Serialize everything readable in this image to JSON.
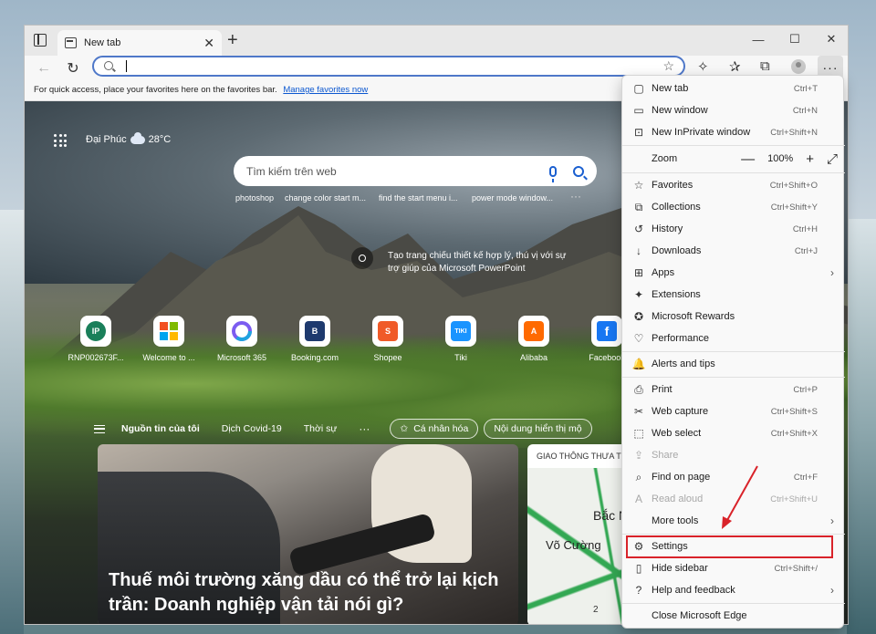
{
  "tab": {
    "title": "New tab",
    "close": "✕",
    "new": "+"
  },
  "window_controls": {
    "minimize": "—",
    "maximize": "☐",
    "close": "✕"
  },
  "toolbar": {
    "back": "←",
    "refresh": "↻",
    "address_value": "",
    "address_placeholder": "",
    "more": "···"
  },
  "favorites_bar": {
    "text": "For quick access, place your favorites here on the favorites bar.",
    "link": "Manage favorites now"
  },
  "newtab": {
    "location": "Đại Phúc",
    "temperature": "28°C",
    "search_placeholder": "Tìm kiếm trên web",
    "suggestions": [
      "photoshop",
      "change color start m...",
      "find the start menu i...",
      "power mode window..."
    ],
    "suggestions_more": "···",
    "promo": "Tạo trang chiếu thiết kế hợp lý, thú vị với sự trợ giúp của Microsoft PowerPoint",
    "quick_links": [
      {
        "label": "RNP002673F...",
        "icon": "IP",
        "color": "#1a7f5a"
      },
      {
        "label": "Welcome to ...",
        "icon": "",
        "color": "#f25022"
      },
      {
        "label": "Microsoft 365",
        "icon": "",
        "color": "#7b5cf0"
      },
      {
        "label": "Booking.com",
        "icon": "B",
        "color": "#1e3a6e"
      },
      {
        "label": "Shopee",
        "icon": "S",
        "color": "#f05a28"
      },
      {
        "label": "Tiki",
        "icon": "TIKI",
        "color": "#1a94ff"
      },
      {
        "label": "Alibaba",
        "icon": "A",
        "color": "#ff6a00"
      },
      {
        "label": "Facebook",
        "icon": "f",
        "color": "#1877f2"
      }
    ],
    "news_tabs": [
      "Nguồn tin của tôi",
      "Dịch Covid-19",
      "Thời sự"
    ],
    "news_more": "···",
    "personalize": "Cá nhân hóa",
    "content_visible": "Nội dung hiển thị mộ",
    "headline": "Thuế môi trường xăng dầu có thể trở lại kịch trần: Doanh nghiệp vận tải nói gì?",
    "map_card": {
      "title": "GIAO THÔNG THƯA TH",
      "place1": "Bắc N",
      "place2": "Võ Cường",
      "count": "2"
    }
  },
  "menu": {
    "zoom_label": "Zoom",
    "zoom_minus": "—",
    "zoom_value": "100%",
    "zoom_plus": "+",
    "items": [
      {
        "label": "New tab",
        "shortcut": "Ctrl+T",
        "icon": "▢"
      },
      {
        "label": "New window",
        "shortcut": "Ctrl+N",
        "icon": "▭"
      },
      {
        "label": "New InPrivate window",
        "shortcut": "Ctrl+Shift+N",
        "icon": "⊡"
      },
      {
        "label": "Favorites",
        "shortcut": "Ctrl+Shift+O",
        "icon": "☆"
      },
      {
        "label": "Collections",
        "shortcut": "Ctrl+Shift+Y",
        "icon": "⧉"
      },
      {
        "label": "History",
        "shortcut": "Ctrl+H",
        "icon": "↺"
      },
      {
        "label": "Downloads",
        "shortcut": "Ctrl+J",
        "icon": "↓"
      },
      {
        "label": "Apps",
        "shortcut": "",
        "icon": "⊞"
      },
      {
        "label": "Extensions",
        "shortcut": "",
        "icon": "✦"
      },
      {
        "label": "Microsoft Rewards",
        "shortcut": "",
        "icon": "✪"
      },
      {
        "label": "Performance",
        "shortcut": "",
        "icon": "♡"
      },
      {
        "label": "Alerts and tips",
        "shortcut": "",
        "icon": "🔔"
      },
      {
        "label": "Print",
        "shortcut": "Ctrl+P",
        "icon": "⎙"
      },
      {
        "label": "Web capture",
        "shortcut": "Ctrl+Shift+S",
        "icon": "✂"
      },
      {
        "label": "Web select",
        "shortcut": "Ctrl+Shift+X",
        "icon": "⬚"
      },
      {
        "label": "Share",
        "shortcut": "",
        "icon": "⇪"
      },
      {
        "label": "Find on page",
        "shortcut": "Ctrl+F",
        "icon": "⌕"
      },
      {
        "label": "Read aloud",
        "shortcut": "Ctrl+Shift+U",
        "icon": "A"
      },
      {
        "label": "More tools",
        "shortcut": "",
        "icon": ""
      },
      {
        "label": "Settings",
        "shortcut": "",
        "icon": "⚙"
      },
      {
        "label": "Hide sidebar",
        "shortcut": "Ctrl+Shift+/",
        "icon": "▯"
      },
      {
        "label": "Help and feedback",
        "shortcut": "",
        "icon": "?"
      },
      {
        "label": "Close Microsoft Edge",
        "shortcut": "",
        "icon": ""
      }
    ]
  },
  "colors": {
    "accent": "#4f78c9",
    "highlight": "#d9232a"
  }
}
